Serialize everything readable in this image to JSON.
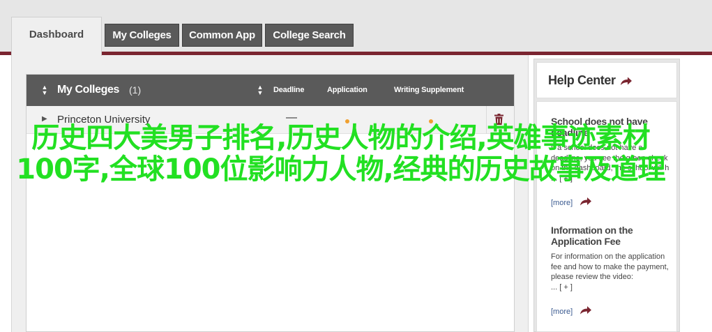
{
  "nav": {
    "tabs": [
      {
        "label": "Dashboard",
        "active": true
      },
      {
        "label": "My Colleges",
        "active": false
      },
      {
        "label": "Common App",
        "active": false
      },
      {
        "label": "College Search",
        "active": false
      }
    ]
  },
  "colleges_panel": {
    "title": "My Colleges",
    "count": "(1)",
    "columns": [
      "Deadline",
      "Application",
      "Writing Supplement"
    ],
    "rows": [
      {
        "name": "Princeton University",
        "deadline": "—"
      }
    ]
  },
  "help_center": {
    "title": "Help Center",
    "articles": [
      {
        "title": "School does not have deadline",
        "body": "If a school does not have a deadline, you see the green check on the dashboard, the school will h\n... [ + ]",
        "more": "[more]"
      },
      {
        "title": "Information on the Application Fee",
        "body": "For information on the application fee and how to make the payment, please review the video:\n... [ + ]",
        "more": "[more]"
      }
    ]
  },
  "overlay_text": "历史四大美男子排名,历史人物的介绍,英雄事迹素材100字,全球100位影响力人物,经典的历史故事及道理",
  "colors": {
    "accent": "#7a2530",
    "tab_bg": "#5a5a5a",
    "overlay": "#22e022",
    "status_dot": "#f0a030"
  }
}
